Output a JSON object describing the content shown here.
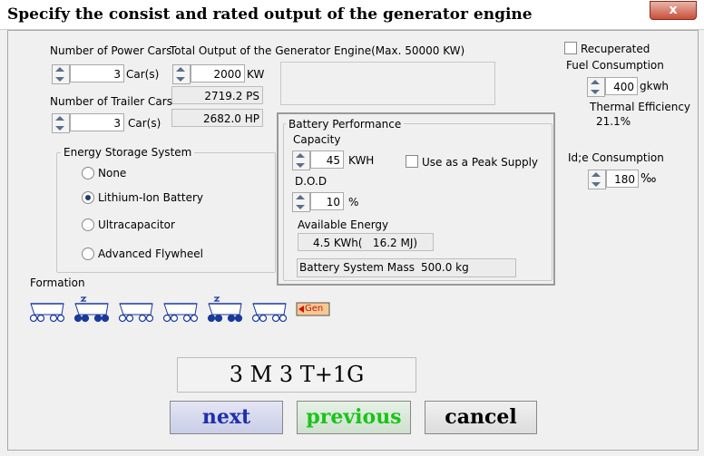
{
  "window": {
    "title": "Specify the consist and rated output of the generator engine",
    "close_label": "x"
  },
  "power_cars": {
    "label": "Number of Power Cars",
    "value": "3",
    "unit": "Car(s)"
  },
  "total_output": {
    "label": "Total Output of the Generator Engine(Max. 50000 KW)",
    "value": "2000",
    "unit": "KW",
    "ps": "2719.2 PS",
    "hp": "2682.0 HP"
  },
  "trailer_cars": {
    "label": "Number of Trailer Cars",
    "value": "3",
    "unit": "Car(s)"
  },
  "energy_storage": {
    "label": "Energy Storage System",
    "options": [
      "None",
      "Lithium-Ion Battery",
      "Ultracapacitor",
      "Advanced Flywheel"
    ],
    "selected": "Lithium-Ion Battery"
  },
  "battery": {
    "label": "Battery Performance",
    "capacity_label": "Capacity",
    "capacity_value": "45",
    "capacity_unit": "KWH",
    "peak_supply_label": "Use as a Peak Supply",
    "dod_label": "D.O.D",
    "dod_value": "10",
    "dod_unit": "%",
    "available_label": "Available Energy",
    "available_value": "4.5 KWh(   16.2 MJ)",
    "mass_label": "Battery System Mass",
    "mass_value": "500.0 kg"
  },
  "engine": {
    "recuperated_label": "Recuperated",
    "fuel_label": "Fuel Consumption",
    "fuel_value": "400",
    "fuel_unit": "gkwh",
    "thermal_label": "Thermal Efficiency",
    "thermal_value": "21.1%",
    "idle_label": "Id;e Consumption",
    "idle_value": "180",
    "idle_unit": "‰"
  },
  "formation": {
    "label": "Formation",
    "cars": [
      "trailer",
      "power",
      "trailer",
      "trailer",
      "power",
      "trailer",
      "generator"
    ],
    "gen_label": "Gen",
    "code": "3 M 3 T+1G"
  },
  "buttons": {
    "next": "next",
    "previous": "previous",
    "cancel": "cancel"
  },
  "colors": {
    "next": "#1e2fb0",
    "previous": "#19c419",
    "cancel": "#000000",
    "wheel": "#1a3a9a"
  }
}
